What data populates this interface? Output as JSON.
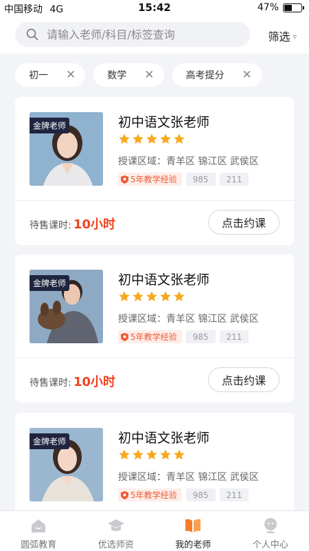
{
  "status_bar": {
    "carrier": "中国移动",
    "network": "4G",
    "time": "15:42",
    "battery": "47%",
    "battery_level": 0.47
  },
  "search": {
    "placeholder": "请输入老师/科目/标签查询",
    "filter_label": "筛选"
  },
  "tags": [
    {
      "label": "初一"
    },
    {
      "label": "数学"
    },
    {
      "label": "高考提分"
    }
  ],
  "teachers": [
    {
      "badge": "金牌老师",
      "name": "初中语文张老师",
      "rating": 5,
      "region_label": "授课区域：",
      "regions": "青羊区 锦江区 武侯区",
      "experience": "5年教学经验",
      "tag1": "985",
      "tag2": "211",
      "hours_label": "待售课时:",
      "hours_value": "10小时",
      "book_label": "点击约课"
    },
    {
      "badge": "金牌老师",
      "name": "初中语文张老师",
      "rating": 5,
      "region_label": "授课区域：",
      "regions": "青羊区 锦江区 武侯区",
      "experience": "5年教学经验",
      "tag1": "985",
      "tag2": "211",
      "hours_label": "待售课时:",
      "hours_value": "10小时",
      "book_label": "点击约课"
    },
    {
      "badge": "金牌老师",
      "name": "初中语文张老师",
      "rating": 5,
      "region_label": "授课区域：",
      "regions": "青羊区 锦江区 武侯区",
      "experience": "5年教学经验",
      "tag1": "985",
      "tag2": "211"
    }
  ],
  "tab_bar": {
    "items": [
      {
        "label": "圆弧教育",
        "icon": "home-icon"
      },
      {
        "label": "优选师资",
        "icon": "graduation-cap-icon"
      },
      {
        "label": "我的老师",
        "icon": "book-icon"
      },
      {
        "label": "个人中心",
        "icon": "user-icon"
      }
    ]
  },
  "colors": {
    "accent": "#f0421e",
    "star": "#f7a81b",
    "active_tab": "#f57b2b"
  }
}
